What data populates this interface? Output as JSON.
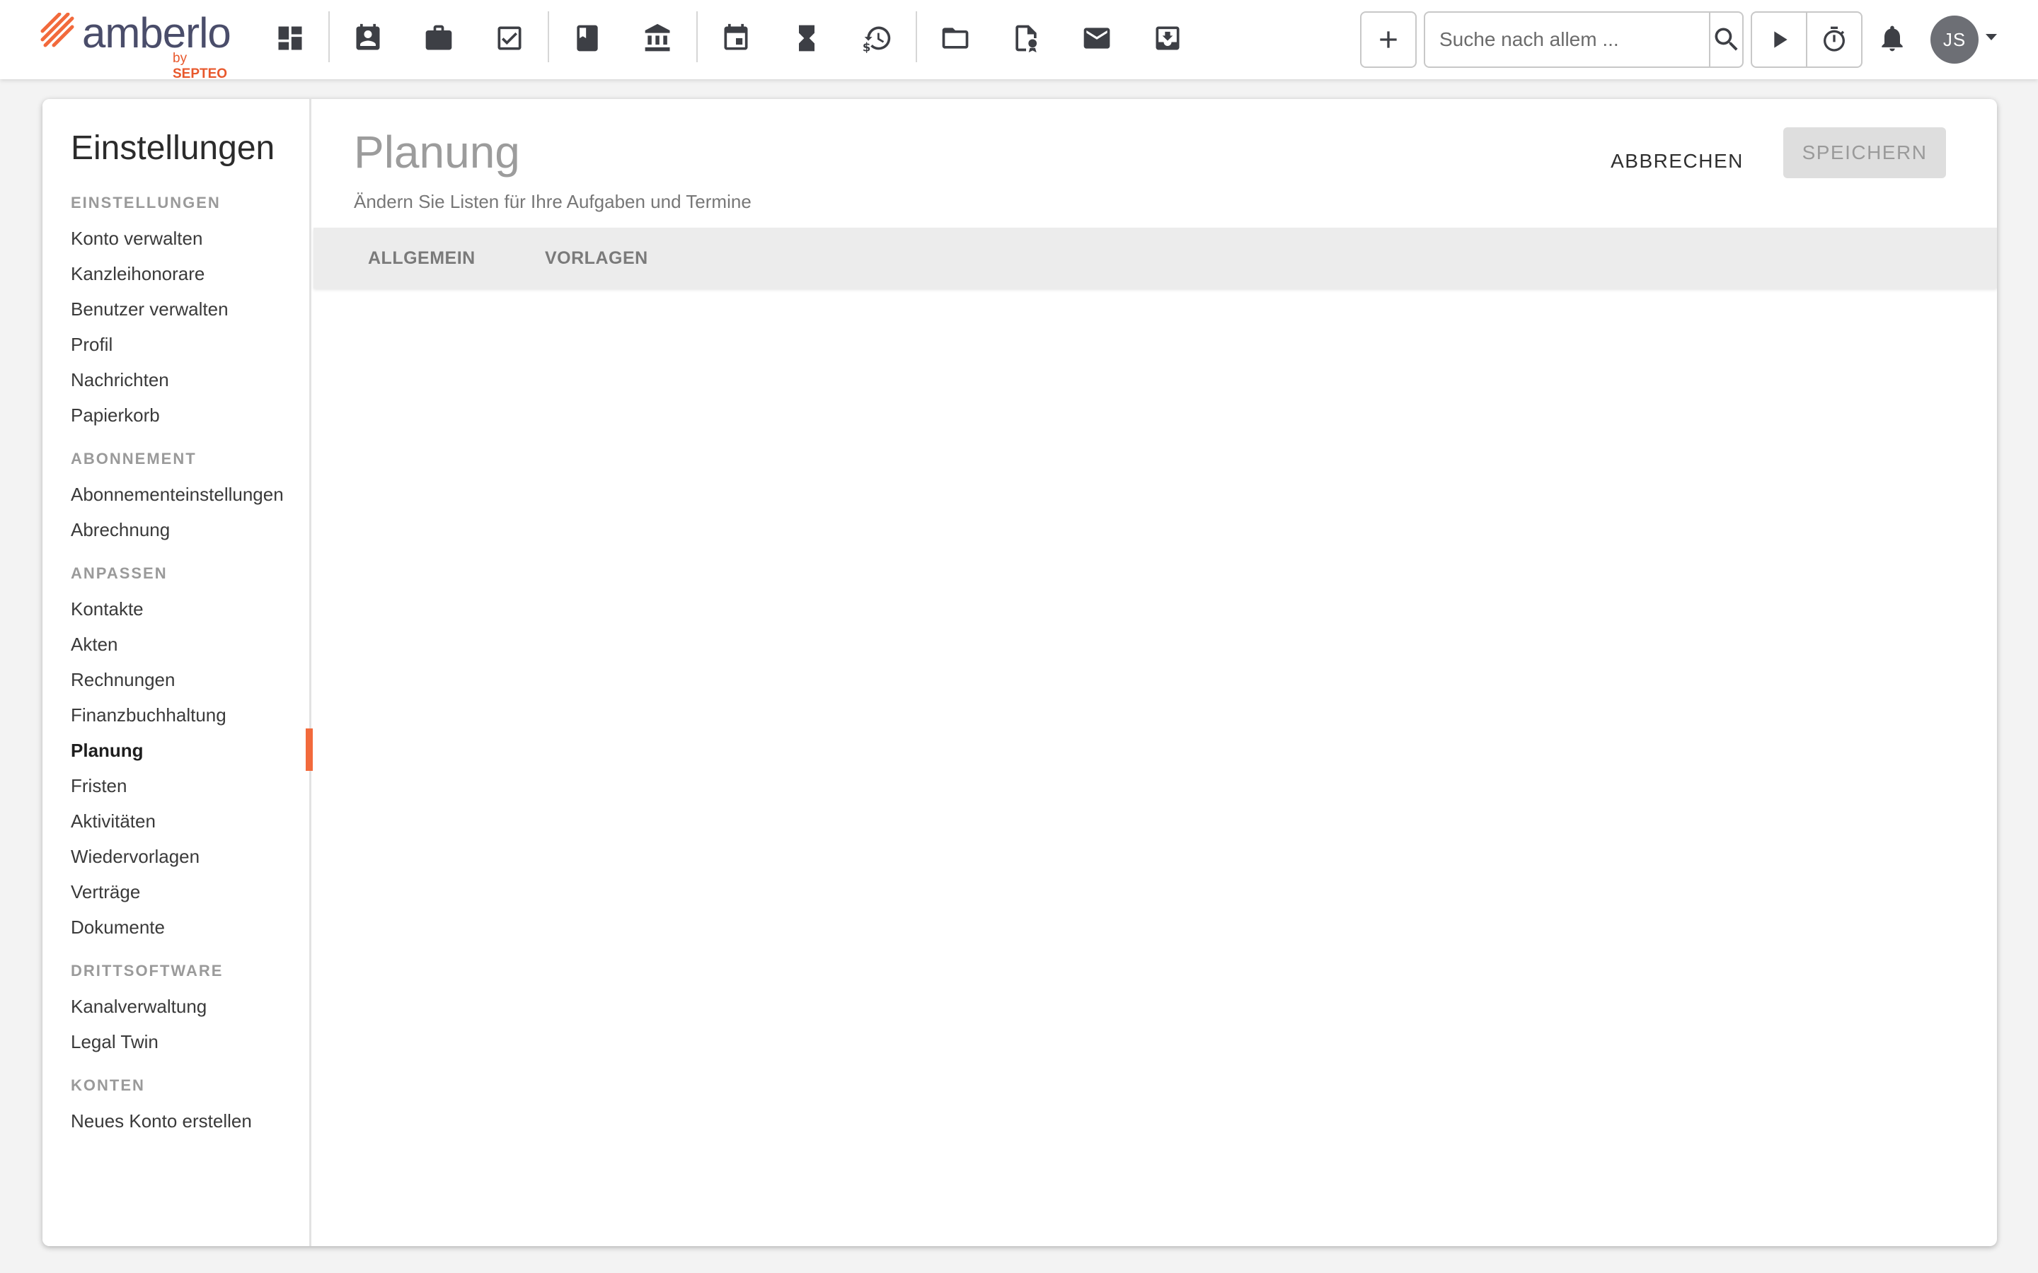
{
  "brand": {
    "name": "amberlo",
    "by": "by",
    "company": "SEPTEO",
    "accent_color": "#f26a3c"
  },
  "topnav": {
    "icons": [
      {
        "name": "dashboard-icon"
      },
      {
        "name": "contacts-icon"
      },
      {
        "name": "matters-briefcase-icon"
      },
      {
        "name": "tasks-check-icon"
      },
      {
        "name": "book-icon"
      },
      {
        "name": "bank-icon"
      },
      {
        "name": "calendar-icon"
      },
      {
        "name": "hourglass-icon"
      },
      {
        "name": "time-billing-icon"
      },
      {
        "name": "folder-icon"
      },
      {
        "name": "document-certificate-icon"
      },
      {
        "name": "mail-icon"
      },
      {
        "name": "inbox-download-icon"
      }
    ],
    "search": {
      "placeholder": "Suche nach allem ..."
    },
    "user": {
      "initials": "JS"
    }
  },
  "sidebar": {
    "title": "Einstellungen",
    "sections": [
      {
        "heading": "EINSTELLUNGEN",
        "items": [
          "Konto verwalten",
          "Kanzleihonorare",
          "Benutzer verwalten",
          "Profil",
          "Nachrichten",
          "Papierkorb"
        ]
      },
      {
        "heading": "ABONNEMENT",
        "items": [
          "Abonnementeinstellungen",
          "Abrechnung"
        ]
      },
      {
        "heading": "ANPASSEN",
        "items": [
          "Kontakte",
          "Akten",
          "Rechnungen",
          "Finanzbuchhaltung",
          "Planung",
          "Fristen",
          "Aktivitäten",
          "Wiedervorlagen",
          "Verträge",
          "Dokumente"
        ]
      },
      {
        "heading": "DRITTSOFTWARE",
        "items": [
          "Kanalverwaltung",
          "Legal Twin"
        ]
      },
      {
        "heading": "KONTEN",
        "items": [
          "Neues Konto erstellen"
        ]
      }
    ],
    "active_item": "Planung"
  },
  "main": {
    "title": "Planung",
    "subtitle": "Ändern Sie Listen für Ihre Aufgaben und Termine",
    "cancel_label": "ABBRECHEN",
    "save_label": "SPEICHERN",
    "tabs": [
      {
        "label": "ALLGEMEIN"
      },
      {
        "label": "VORLAGEN"
      }
    ]
  }
}
